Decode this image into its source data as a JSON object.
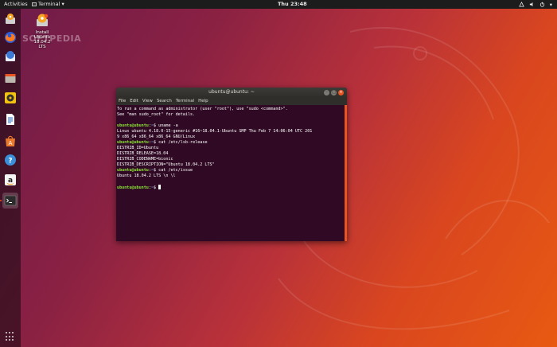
{
  "topbar": {
    "activities": "Activities",
    "app_menu": "Terminal",
    "app_menu_arrow": "▾",
    "clock": "Thu 23:48",
    "tray": {
      "network_icon": "network-icon",
      "volume_icon": "volume-icon",
      "power_icon": "power-icon",
      "menu_arrow": "▾"
    }
  },
  "desktop": {
    "icons": [
      {
        "label_line1": "Install",
        "label_line2": "Ubuntu",
        "label_line3": "18.04.2 LTS",
        "icon": "installer-disk-icon"
      }
    ],
    "watermark": "SOFTPEDIA"
  },
  "dock": {
    "items": [
      {
        "name": "dock-item-installer",
        "icon": "installer-icon",
        "active": false
      },
      {
        "name": "dock-item-firefox",
        "icon": "firefox-icon",
        "active": false
      },
      {
        "name": "dock-item-thunderbird",
        "icon": "thunderbird-icon",
        "active": false
      },
      {
        "name": "dock-item-files",
        "icon": "files-icon",
        "active": false
      },
      {
        "name": "dock-item-rhythmbox",
        "icon": "rhythmbox-icon",
        "active": false
      },
      {
        "name": "dock-item-writer",
        "icon": "libreoffice-writer-icon",
        "active": false
      },
      {
        "name": "dock-item-software",
        "icon": "software-center-icon",
        "active": false
      },
      {
        "name": "dock-item-help",
        "icon": "help-icon",
        "active": false
      },
      {
        "name": "dock-item-amazon",
        "icon": "amazon-icon",
        "active": false
      },
      {
        "name": "dock-item-terminal",
        "icon": "terminal-icon",
        "active": true
      }
    ],
    "show_apps_icon": "show-applications-icon"
  },
  "terminal": {
    "title": "ubuntu@ubuntu: ~",
    "buttons": {
      "minimize": "–",
      "maximize": "□",
      "close": "×"
    },
    "menu": [
      "File",
      "Edit",
      "View",
      "Search",
      "Terminal",
      "Help"
    ],
    "lines": [
      {
        "type": "text",
        "text": "To run a command as administrator (user \"root\"), use \"sudo <command>\"."
      },
      {
        "type": "text",
        "text": "See \"man sudo_root\" for details."
      },
      {
        "type": "text",
        "text": ""
      },
      {
        "type": "prompt",
        "user": "ubuntu@ubuntu",
        "path": "~",
        "cmd": " uname -a"
      },
      {
        "type": "text",
        "text": "Linux ubuntu 4.18.0-15-generic #16~18.04.1-Ubuntu SMP Thu Feb 7 14:06:04 UTC 201"
      },
      {
        "type": "text",
        "text": "9 x86_64 x86_64 x86_64 GNU/Linux"
      },
      {
        "type": "prompt",
        "user": "ubuntu@ubuntu",
        "path": "~",
        "cmd": " cat /etc/lsb-release"
      },
      {
        "type": "text",
        "text": "DISTRIB_ID=Ubuntu"
      },
      {
        "type": "text",
        "text": "DISTRIB_RELEASE=18.04"
      },
      {
        "type": "text",
        "text": "DISTRIB_CODENAME=bionic"
      },
      {
        "type": "text",
        "text": "DISTRIB_DESCRIPTION=\"Ubuntu 18.04.2 LTS\""
      },
      {
        "type": "prompt",
        "user": "ubuntu@ubuntu",
        "path": "~",
        "cmd": " cat /etc/issue"
      },
      {
        "type": "text",
        "text": "Ubuntu 18.04.2 LTS \\n \\l"
      },
      {
        "type": "text",
        "text": ""
      },
      {
        "type": "prompt",
        "user": "ubuntu@ubuntu",
        "path": "~",
        "cmd": " ",
        "cursor": true
      }
    ]
  },
  "colors": {
    "accent": "#e95420",
    "terminal_bg": "#300a24",
    "prompt_user": "#8ae234",
    "prompt_path": "#729fcf"
  }
}
